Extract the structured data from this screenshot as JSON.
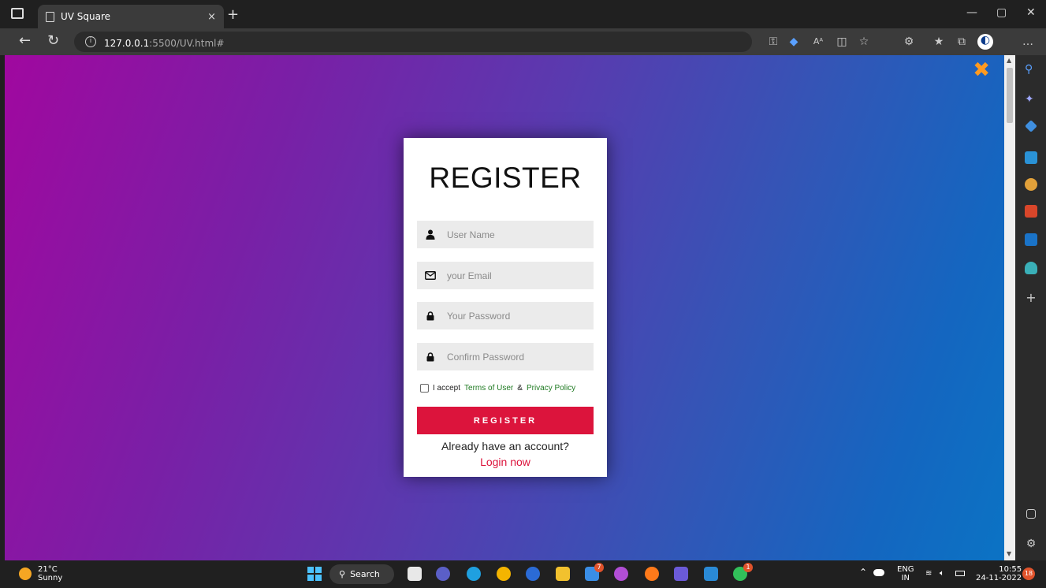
{
  "browser": {
    "tab": {
      "title": "UV Square",
      "close_glyph": "×"
    },
    "new_tab_glyph": "+",
    "window_controls": {
      "minimize": "—",
      "restore": "▢",
      "close": "✕"
    },
    "nav": {
      "back": "←",
      "refresh": "↻"
    },
    "url": {
      "host": "127.0.0.1",
      "path": ":5500/UV.html#"
    },
    "toolbar_icons": [
      "key-icon",
      "tag-icon",
      "read-aloud-icon",
      "split-screen-icon",
      "favorite-add-icon",
      "extensions-icon",
      "favorites-icon",
      "collections-icon",
      "profile-icon",
      "more-icon"
    ],
    "more_glyph": "…"
  },
  "page": {
    "close_glyph": "✖",
    "form": {
      "title": "REGISTER",
      "fields": [
        {
          "icon": "user-icon",
          "placeholder": "User Name",
          "type": "text"
        },
        {
          "icon": "envelope-icon",
          "placeholder": "your Email",
          "type": "email"
        },
        {
          "icon": "lock-icon",
          "placeholder": "Your Password",
          "type": "password"
        },
        {
          "icon": "lock-icon",
          "placeholder": "Confirm Password",
          "type": "password"
        }
      ],
      "terms": {
        "prefix": "I accept",
        "terms_link": "Terms of User",
        "ampersand": "&",
        "privacy_link": "Privacy Policy",
        "checked": false
      },
      "submit_label": "REGISTER",
      "already_text": "Already have an account?",
      "login_link": "Login now"
    },
    "colors": {
      "accent": "#dc143c",
      "link_green": "#1f7a22",
      "gradient_start": "#a0089f",
      "gradient_end": "#0b73c4"
    }
  },
  "sidebar": {
    "icons": [
      "search-icon",
      "copilot-icon",
      "shopping-icon",
      "tools-icon",
      "games-icon",
      "office-icon",
      "outlook-icon",
      "drop-icon",
      "add-icon",
      "sidebar-toggle-icon",
      "settings-icon"
    ],
    "add_glyph": "+"
  },
  "taskbar": {
    "weather": {
      "temp": "21°C",
      "condition": "Sunny"
    },
    "search_label": "Search",
    "apps": [
      "task-view-icon",
      "meet-icon",
      "edge-icon",
      "chrome-icon",
      "wordpad-icon",
      "file-explorer-icon",
      "mail-icon",
      "game-icon",
      "firefox-icon",
      "teams-icon",
      "vscode-icon",
      "whatsapp-icon"
    ],
    "badges": {
      "mail": "7",
      "whatsapp": "1"
    },
    "tray": {
      "lang_top": "ENG",
      "lang_bottom": "IN"
    },
    "clock": {
      "time": "10:55",
      "date": "24-11-2022"
    },
    "notification_count": "18"
  }
}
